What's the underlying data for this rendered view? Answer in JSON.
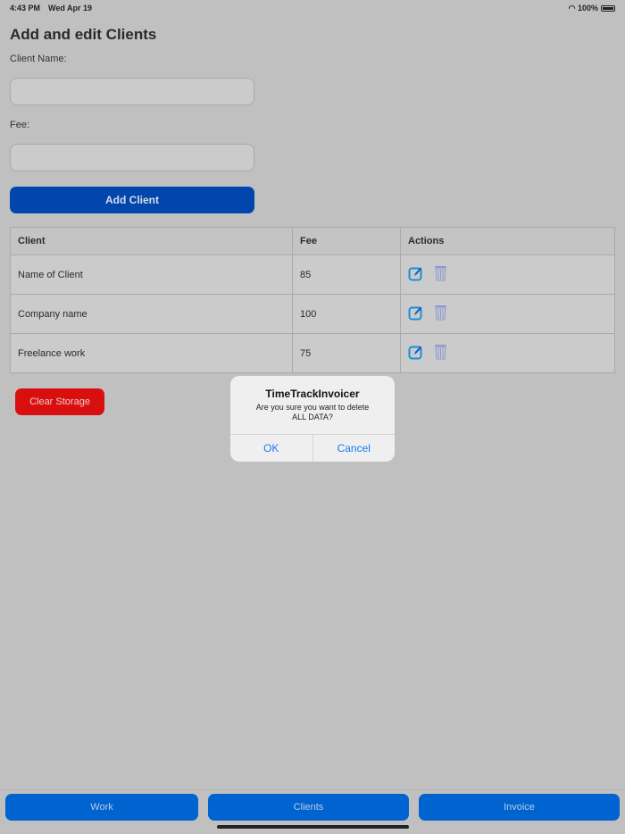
{
  "status": {
    "time": "4:43 PM",
    "date": "Wed Apr 19",
    "battery": "100%"
  },
  "title": "Add and edit Clients",
  "form": {
    "name_label": "Client Name:",
    "name_value": "",
    "fee_label": "Fee:",
    "fee_value": "",
    "add_label": "Add Client"
  },
  "table": {
    "headers": [
      "Client",
      "Fee",
      "Actions"
    ],
    "rows": [
      {
        "client": "Name of Client",
        "fee": "85"
      },
      {
        "client": "Company name",
        "fee": "100"
      },
      {
        "client": "Freelance work",
        "fee": "75"
      }
    ]
  },
  "clear_label": "Clear Storage",
  "alert": {
    "title": "TimeTrackInvoicer",
    "message": "Are you sure you want to delete ALL DATA?",
    "ok": "OK",
    "cancel": "Cancel"
  },
  "tabs": [
    "Work",
    "Clients",
    "Invoice"
  ],
  "colors": {
    "primary": "#0046ad",
    "tab": "#0064d0",
    "danger": "#d90f0f"
  }
}
